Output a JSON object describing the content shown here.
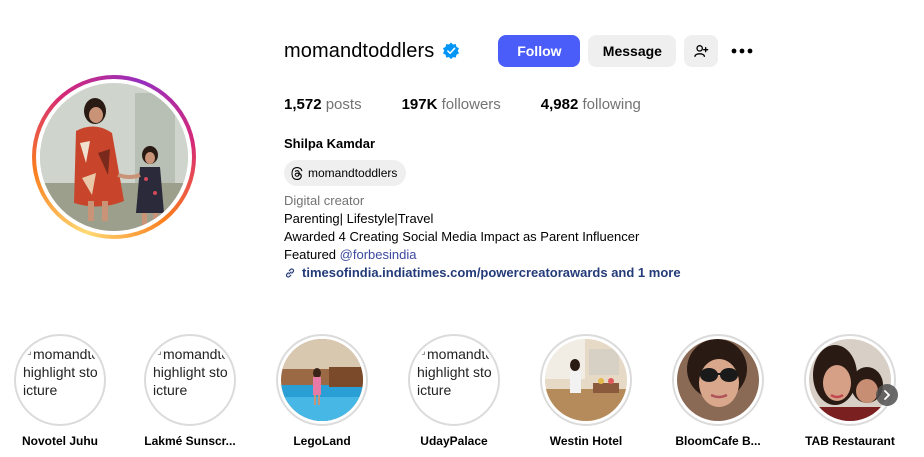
{
  "profile": {
    "username": "momandtoddlers",
    "verified": true,
    "full_name": "Shilpa Kamdar",
    "threads_handle": "momandtoddlers"
  },
  "actions": {
    "follow_label": "Follow",
    "message_label": "Message",
    "add_icon": "person-add-icon",
    "more_icon": "more-options-icon"
  },
  "stats": {
    "posts_count": "1,572",
    "posts_label": "posts",
    "followers_count": "197K",
    "followers_label": "followers",
    "following_count": "4,982",
    "following_label": "following"
  },
  "bio": {
    "category": "Digital creator",
    "line1": "Parenting| Lifestyle|Travel",
    "line2": "Awarded 4 Creating Social Media Impact as Parent Influencer",
    "line3_prefix": "Featured ",
    "mention": "@forbesindia",
    "link_text": "timesofindia.indiatimes.com/powercreatorawards and 1 more"
  },
  "highlights": [
    {
      "label": "Novotel Juhu",
      "alt": "momandtoddlers's highlight story picture",
      "alt_lines": [
        "momandtoo",
        "highlight sto",
        "icture"
      ],
      "image": "broken"
    },
    {
      "label": "Lakmé Sunscr...",
      "alt": "momandtoddlers's highlight story picture",
      "alt_lines": [
        "momandtoo",
        "highlight sto",
        "icture"
      ],
      "image": "broken"
    },
    {
      "label": "LegoLand",
      "image": "pool-photo"
    },
    {
      "label": "UdayPalace",
      "alt": "momandtoddlers's highlight story picture",
      "alt_lines": [
        "momandtoo",
        "highlight sto",
        "icture"
      ],
      "image": "broken"
    },
    {
      "label": "Westin Hotel",
      "image": "hotel-room-photo"
    },
    {
      "label": "BloomCafe B...",
      "image": "sunglasses-selfie-photo"
    },
    {
      "label": "TAB Restaurant",
      "image": "mother-child-selfie-photo"
    }
  ],
  "colors": {
    "follow_button": "#4a5df9",
    "secondary_button": "#efefef",
    "muted_text": "#737373",
    "link_text": "#243b7a",
    "verified_badge": "#0095f6"
  }
}
